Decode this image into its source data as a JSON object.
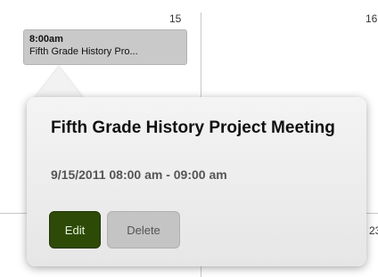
{
  "calendar": {
    "day_numbers": {
      "d15": "15",
      "d16": "16",
      "d23": "23"
    }
  },
  "event": {
    "time": "8:00am",
    "title_truncated": "Fifth Grade History Pro..."
  },
  "popover": {
    "title": "Fifth Grade History Project Meeting",
    "date_range": "9/15/2011 08:00 am - 09:00 am",
    "edit_label": "Edit",
    "delete_label": "Delete"
  },
  "colors": {
    "edit_button": "#2d4a07",
    "delete_button": "#c4c4c4",
    "event_chip": "#c9c9c9"
  }
}
